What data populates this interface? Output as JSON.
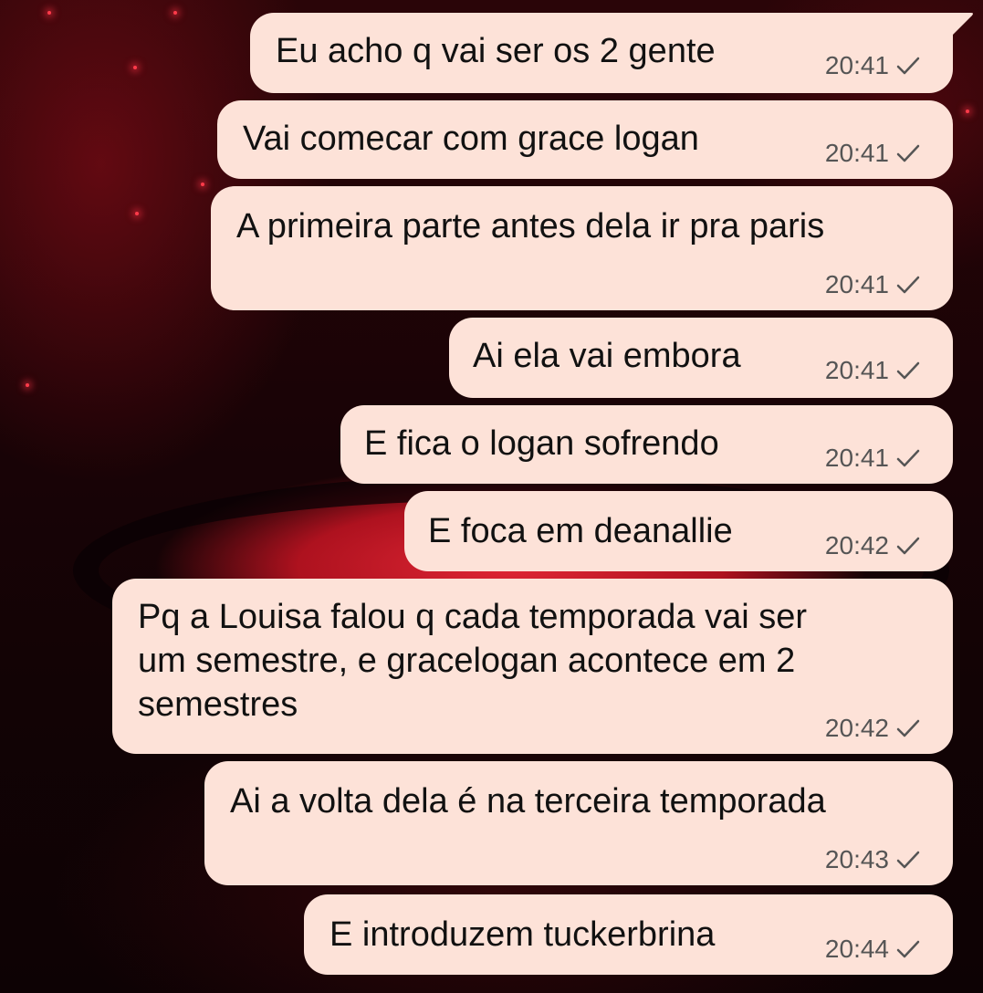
{
  "messages": [
    {
      "text": "Eu acho q vai ser os 2 gente",
      "time": "20:41",
      "status_icon": "check-icon"
    },
    {
      "text": "Vai comecar com grace logan",
      "time": "20:41",
      "status_icon": "check-icon"
    },
    {
      "text": "A primeira parte antes dela ir pra paris",
      "time": "20:41",
      "status_icon": "check-icon"
    },
    {
      "text": "Ai ela vai embora",
      "time": "20:41",
      "status_icon": "check-icon"
    },
    {
      "text": "E fica o logan sofrendo",
      "time": "20:41",
      "status_icon": "check-icon"
    },
    {
      "text": "E foca em deanallie",
      "time": "20:42",
      "status_icon": "check-icon"
    },
    {
      "text": "Pq a Louisa falou q cada temporada vai ser\num semestre, e gracelogan acontece em 2\nsemestres",
      "time": "20:42",
      "status_icon": "check-icon"
    },
    {
      "text": "Ai a volta dela é na terceira temporada",
      "time": "20:43",
      "status_icon": "check-icon"
    },
    {
      "text": "E introduzem tuckerbrina",
      "time": "20:44",
      "status_icon": "check-icon"
    }
  ],
  "colors": {
    "bubble": "#fde2d8",
    "text": "#111111",
    "meta": "#555555",
    "wallpaper_accent": "#e82837"
  }
}
